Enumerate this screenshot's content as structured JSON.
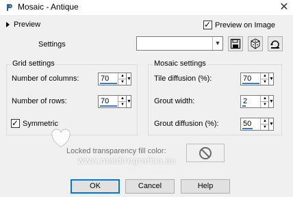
{
  "window": {
    "title": "Mosaic - Antique"
  },
  "preview": {
    "label": "Preview",
    "preview_on_image_label": "Preview on Image",
    "preview_on_image_checked": true
  },
  "settings": {
    "label": "Settings",
    "value": ""
  },
  "grid": {
    "title": "Grid settings",
    "columns_label": "Number of columns:",
    "columns_value": "70",
    "rows_label": "Number of rows:",
    "rows_value": "70",
    "symmetric_label": "Symmetric",
    "symmetric_checked": true
  },
  "mosaic": {
    "title": "Mosaic settings",
    "tile_label": "Tile diffusion (%):",
    "tile_value": "70",
    "grout_width_label": "Grout width:",
    "grout_width_value": "2",
    "grout_diff_label": "Grout diffusion (%):",
    "grout_diff_value": "50"
  },
  "locked": {
    "label": "Locked transparency fill color:"
  },
  "watermark": {
    "text": "www.maldiregrafica.eu"
  },
  "buttons": {
    "ok": "OK",
    "cancel": "Cancel",
    "help": "Help"
  },
  "colors": {
    "accent": "#0078d7",
    "spin_underline": "#2f7dd6"
  }
}
